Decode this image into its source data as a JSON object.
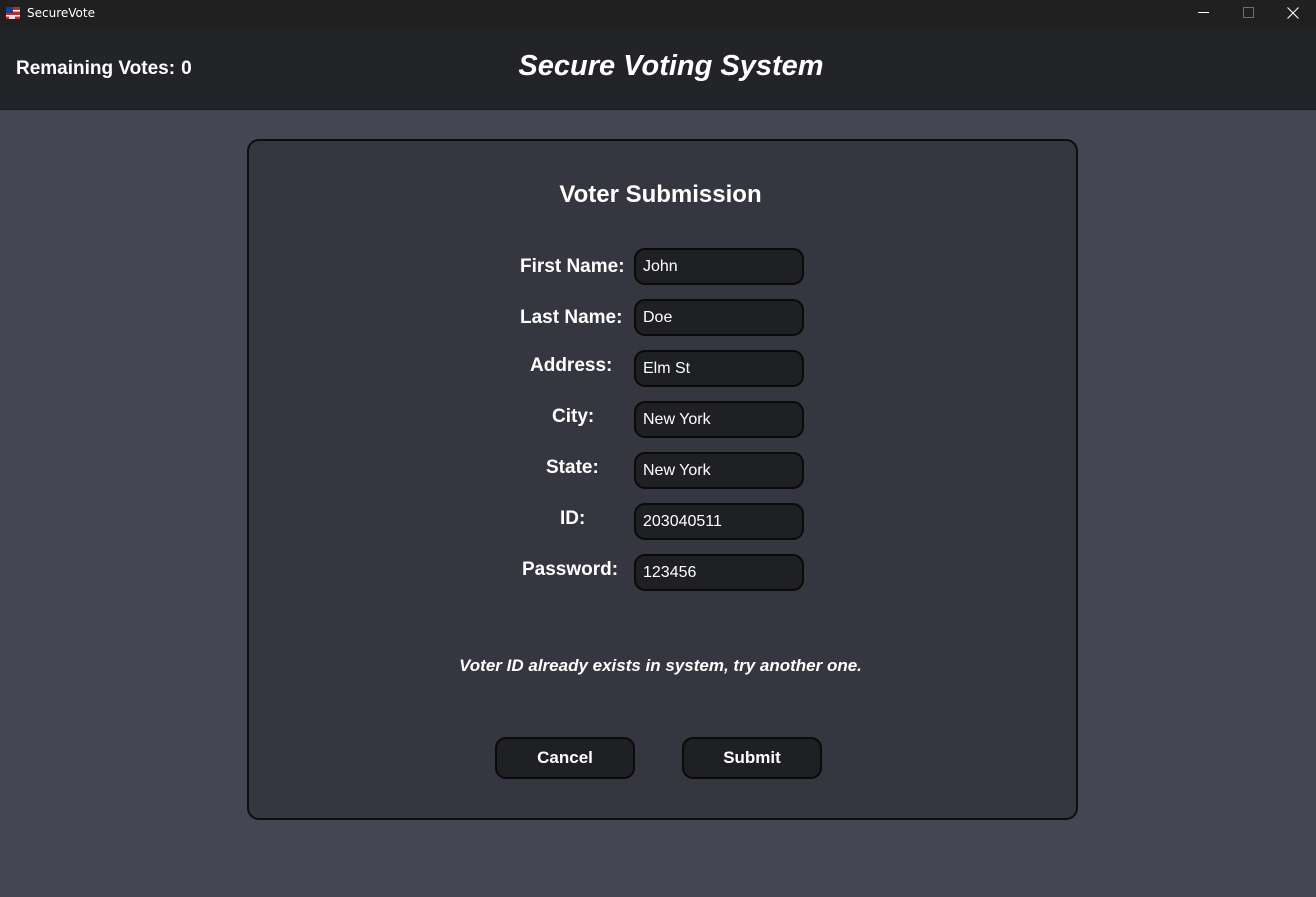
{
  "window": {
    "title": "SecureVote",
    "minimize_glyph": "—",
    "maximize_glyph": "☐",
    "close_glyph": "✕"
  },
  "header": {
    "remaining_label": "Remaining Votes:",
    "remaining_count": "0",
    "app_title": "Secure Voting System"
  },
  "form": {
    "title": "Voter Submission",
    "fields": [
      {
        "label": "First Name:",
        "value": "John"
      },
      {
        "label": "Last Name:",
        "value": "Doe"
      },
      {
        "label": "Address:",
        "value": "Elm St"
      },
      {
        "label": "City:",
        "value": "New York"
      },
      {
        "label": "State:",
        "value": "New York"
      },
      {
        "label": "ID:",
        "value": "203040511"
      },
      {
        "label": "Password:",
        "value": "123456"
      }
    ],
    "message": "Voter ID already exists in system, try another one.",
    "cancel_label": "Cancel",
    "submit_label": "Submit"
  },
  "colors": {
    "background": "#454654",
    "header": "#232427",
    "card": "#35363f",
    "input": "#1f2023",
    "text": "#ffffff"
  }
}
